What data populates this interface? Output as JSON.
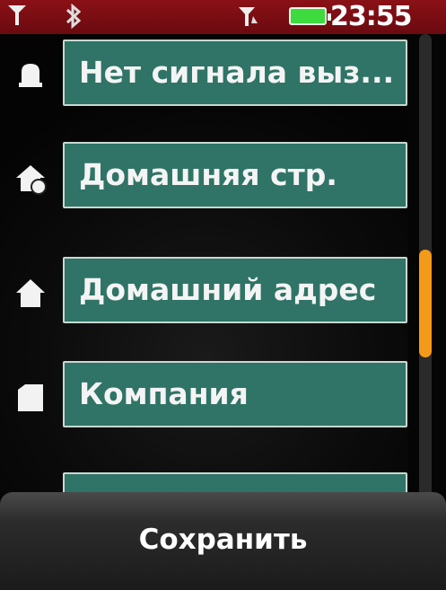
{
  "status_bar": {
    "time": "23:55",
    "signal_icon": "antenna-icon",
    "bluetooth_icon": "bluetooth-icon",
    "antenna_icon": "antenna-arrow-icon",
    "battery_icon": "battery-icon"
  },
  "fields": [
    {
      "label": "Нет сигнала выз...",
      "icon": "bell-icon"
    },
    {
      "label": "Домашняя стр.",
      "icon": "home-page-icon"
    },
    {
      "label": "Домашний адрес",
      "icon": "home-icon"
    },
    {
      "label": "Компания",
      "icon": "company-icon"
    }
  ],
  "bottom": {
    "save_label": "Сохранить"
  },
  "colors": {
    "status_bg": "#7a0d12",
    "field_bg": "#2f7466",
    "scroll_thumb": "#f39a1a"
  }
}
